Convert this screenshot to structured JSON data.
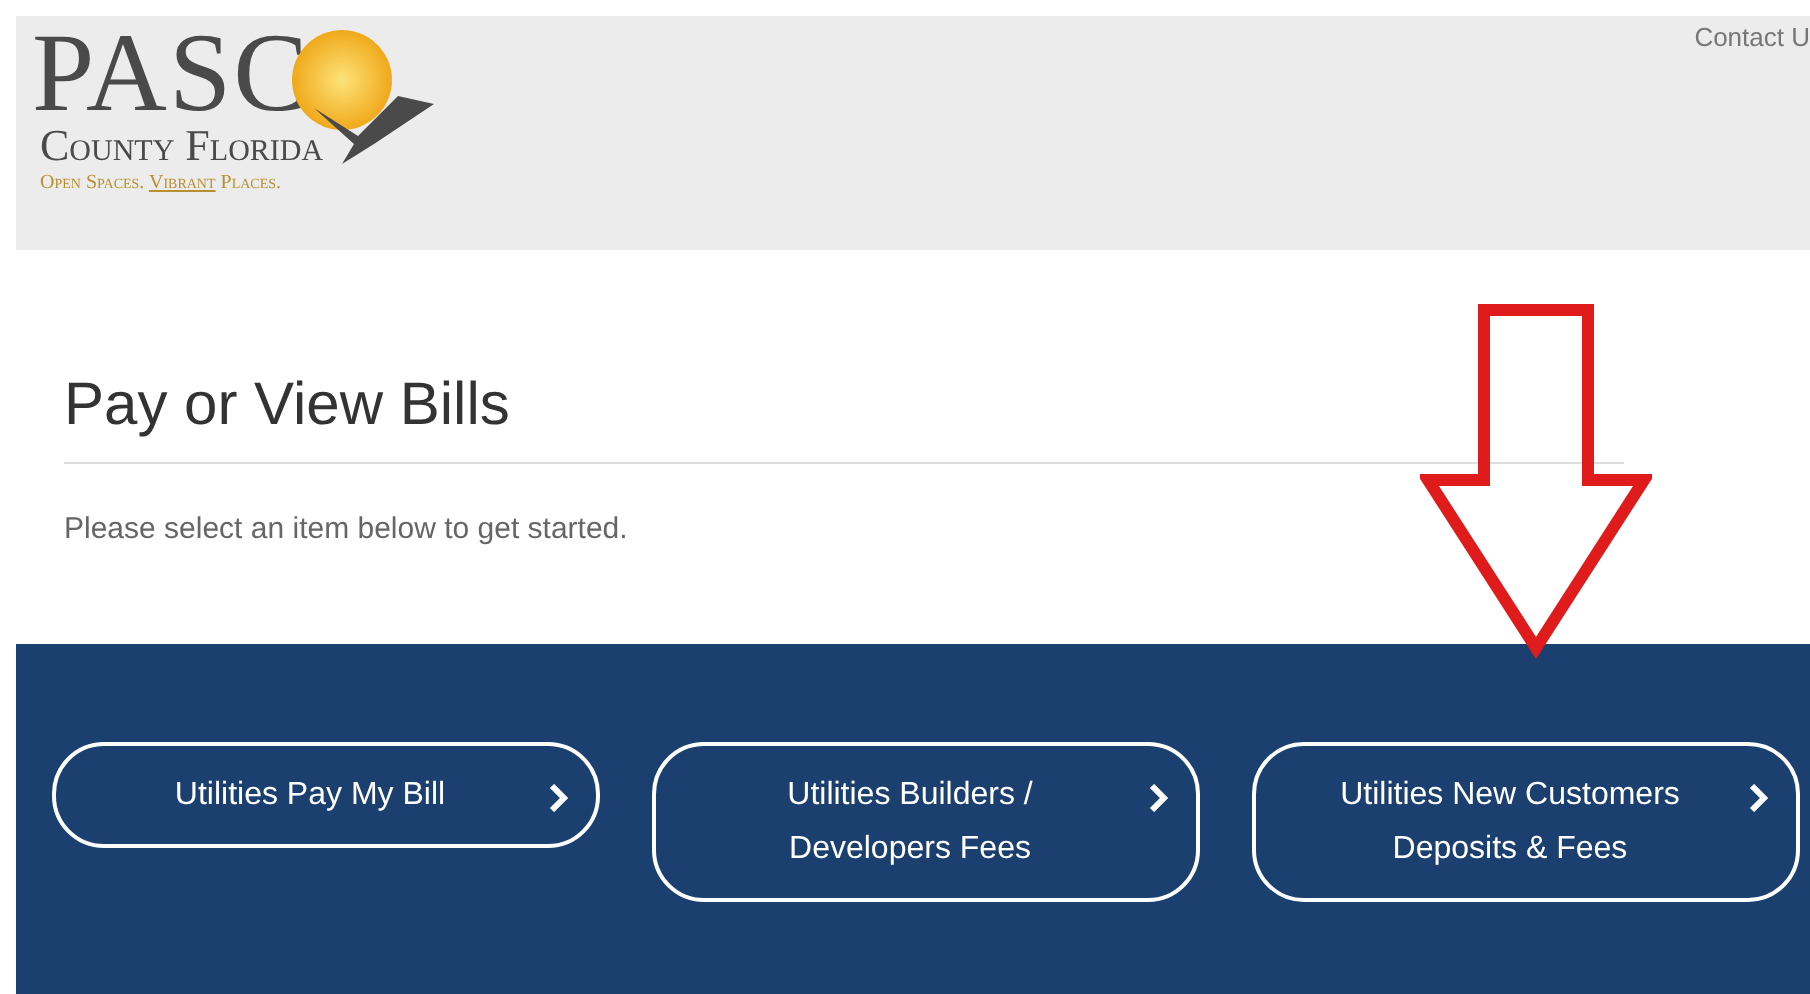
{
  "header": {
    "logo": {
      "wordmark": "PASC",
      "subtitle": "County Florida",
      "tagline_parts": [
        "Open Spaces. ",
        "Vibrant",
        " Places."
      ]
    },
    "contact_link": "Contact U"
  },
  "content": {
    "title": "Pay or View Bills",
    "intro": "Please select an item below to get started."
  },
  "options": [
    {
      "lines": [
        "Utilities Pay My Bill"
      ]
    },
    {
      "lines": [
        "Utilities Builders /",
        "Developers Fees"
      ]
    },
    {
      "lines": [
        "Utilities New Customers",
        "Deposits & Fees"
      ]
    }
  ]
}
